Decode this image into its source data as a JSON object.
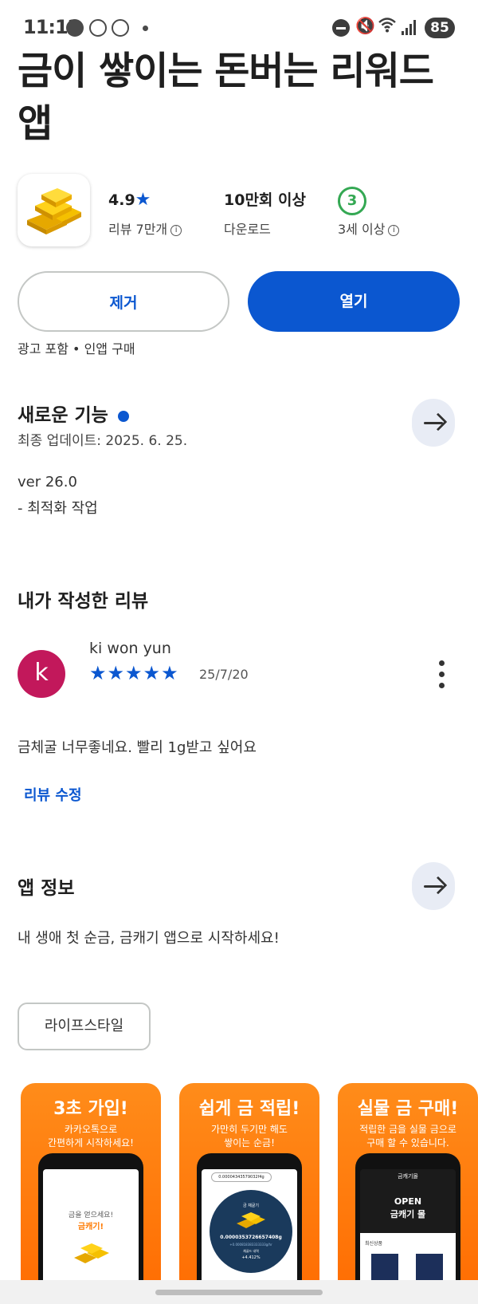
{
  "status_bar": {
    "time": "11:12",
    "battery": "85"
  },
  "app": {
    "title": "금이 쌓이는 돈버는 리워드 앱",
    "rating": "4.9",
    "reviews_label": "리뷰 7만개",
    "downloads": "10만회 이상",
    "downloads_label": "다운로드",
    "age_rating": "3",
    "age_label": "3세 이상",
    "remove_button": "제거",
    "open_button": "열기",
    "ads_note": "광고 포함 • 인앱 구매"
  },
  "whats_new": {
    "title": "새로운 기능",
    "updated": "최종 업데이트: 2025. 6. 25.",
    "version": "ver 26.0",
    "notes": "- 최적화 작업"
  },
  "my_review": {
    "title": "내가 작성한 리뷰",
    "avatar_letter": "k",
    "reviewer": "ki won yun",
    "stars": 5,
    "stars_text": "★★★★★",
    "date": "25/7/20",
    "text": "금체굴 너무좋네요. 빨리 1g받고 싶어요",
    "edit_label": "리뷰 수정"
  },
  "about": {
    "title": "앱 정보",
    "description": "내 생애 첫 순금, 금캐기 앱으로 시작하세요!",
    "category": "라이프스타일"
  },
  "screenshots": [
    {
      "title": "3초 가입!",
      "subtitle": "카카오톡으로\n간편하게 시작하세요!",
      "screen_top": "금을 얻으세요!",
      "screen_accent": "금캐기!"
    },
    {
      "title": "쉽게 금 적립!",
      "subtitle": "가만히 두기만 해도\n쌓이는 순금!",
      "screen_top": "0.00004343579032f4g",
      "screen_label": "금 채굴기",
      "screen_value": "0.0000353726657408g",
      "screen_rate": "+0.000818383333333g/hr",
      "screen_history": "채굴드 내역",
      "screen_pct": "+4.412%"
    },
    {
      "title": "실물 금 구매!",
      "subtitle": "적립한 금을 실물 금으로\n구매 할 수 있습니다.",
      "screen_brand": "금캐기몰",
      "screen_banner": "OPEN",
      "screen_banner2": "금캐기 몰",
      "screen_section": "최신상품"
    }
  ],
  "colors": {
    "accent": "#0b57d0",
    "avatar": "#c2185b",
    "age_badge": "#34a853",
    "screenshot_bg": "#ff7a0d"
  }
}
